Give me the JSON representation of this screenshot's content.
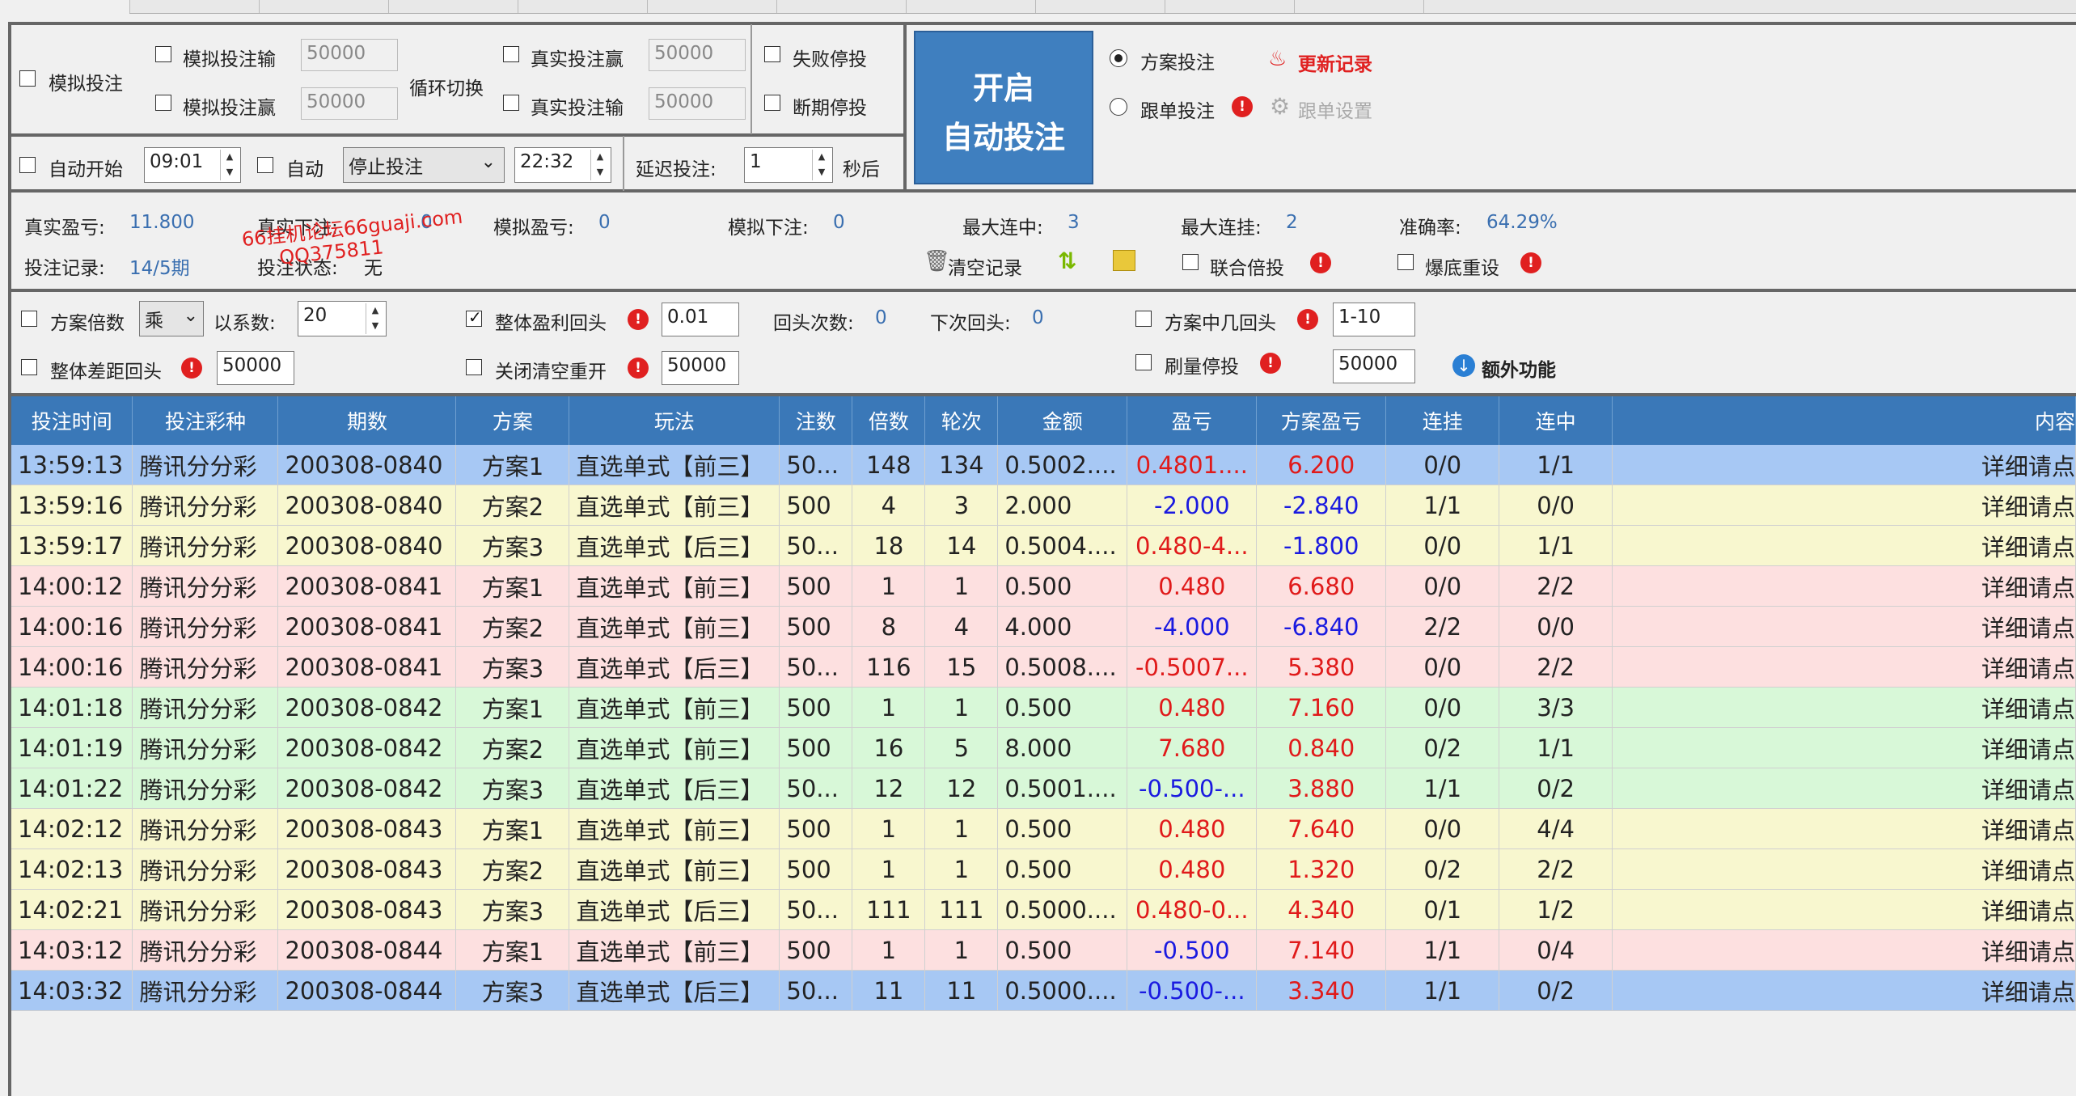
{
  "top": {
    "sim_bet": "模拟投注",
    "sim_loss": "模拟投注输",
    "sim_win": "模拟投注赢",
    "sim_loss_value": "50000",
    "sim_win_value": "50000",
    "cycle": "循环切换",
    "real_win": "真实投注赢",
    "real_loss": "真实投注输",
    "real_win_value": "50000",
    "real_loss_value": "50000",
    "fail_stop": "失败停投",
    "break_stop": "断期停投",
    "start_btn_line1": "开启",
    "start_btn_line2": "自动投注",
    "plan_bet": "方案投注",
    "follow_bet": "跟单投注",
    "update_log": "更新记录",
    "follow_settings": "跟单设置",
    "auto_start": "自动开始",
    "auto_start_time": "09:01",
    "auto": "自动",
    "stop_bet": "停止投注",
    "stop_time": "22:32",
    "delay": "延迟投注:",
    "delay_value": "1",
    "seconds": "秒后"
  },
  "stats": {
    "real_pl_label": "真实盈亏:",
    "real_pl": "11.800",
    "real_bet_label": "真实下注:",
    "real_bet": "0",
    "sim_pl_label": "模拟盈亏:",
    "sim_pl": "0",
    "sim_bet_label": "模拟下注:",
    "sim_bet": "0",
    "max_win_label": "最大连中:",
    "max_win": "3",
    "max_loss_label": "最大连挂:",
    "max_loss": "2",
    "accuracy_label": "准确率:",
    "accuracy": "64.29%",
    "record_label": "投注记录:",
    "record": "14/5期",
    "status_label": "投注状态:",
    "status": "无",
    "clear": "清空记录",
    "joint_double": "联合倍投",
    "bust_reset": "爆底重设",
    "watermark1": "66挂机论坛66guaji.com",
    "watermark2": "QQ375811"
  },
  "opts": {
    "plan_mult": "方案倍数",
    "mult_op": "乘",
    "coef_label": "以系数:",
    "coef": "20",
    "total_profit_back": "整体盈利回头",
    "total_profit_value": "0.01",
    "back_count_label": "回头次数:",
    "back_count": "0",
    "next_back_label": "下次回头:",
    "next_back": "0",
    "plan_hit_back": "方案中几回头",
    "plan_hit_value": "1-10",
    "total_gap_back": "整体差距回头",
    "total_gap_value": "50000",
    "close_reset": "关闭清空重开",
    "close_reset_value": "50000",
    "volume_stop": "刷量停投",
    "volume_stop_value": "50000",
    "extra": "额外功能"
  },
  "table": {
    "headers": [
      "投注时间",
      "投注彩种",
      "期数",
      "方案",
      "玩法",
      "注数",
      "倍数",
      "轮次",
      "金额",
      "盈亏",
      "方案盈亏",
      "连挂",
      "连中",
      "内容"
    ],
    "rows": [
      {
        "c": [
          "13:59:13",
          "腾讯分分彩",
          "200308-0840",
          "方案1",
          "直选单式【前三】",
          "50...",
          "148",
          "134",
          "0.5002....",
          "0.4801....",
          "6.200",
          "0/0",
          "1/1",
          "详细请点"
        ],
        "bg": "#a7c8f4",
        "pl": "pos",
        "ppl": "pos"
      },
      {
        "c": [
          "13:59:16",
          "腾讯分分彩",
          "200308-0840",
          "方案2",
          "直选单式【前三】",
          "500",
          "4",
          "3",
          "2.000",
          "-2.000",
          "-2.840",
          "1/1",
          "0/0",
          "详细请点"
        ],
        "bg": "#f8f7cf",
        "pl": "neg",
        "ppl": "neg"
      },
      {
        "c": [
          "13:59:17",
          "腾讯分分彩",
          "200308-0840",
          "方案3",
          "直选单式【后三】",
          "50...",
          "18",
          "14",
          "0.5004....",
          "0.480-4...",
          "-1.800",
          "0/0",
          "1/1",
          "详细请点"
        ],
        "bg": "#f8f7cf",
        "pl": "pos",
        "ppl": "neg"
      },
      {
        "c": [
          "14:00:12",
          "腾讯分分彩",
          "200308-0841",
          "方案1",
          "直选单式【前三】",
          "500",
          "1",
          "1",
          "0.500",
          "0.480",
          "6.680",
          "0/0",
          "2/2",
          "详细请点"
        ],
        "bg": "#fde0e0",
        "pl": "pos",
        "ppl": "pos"
      },
      {
        "c": [
          "14:00:16",
          "腾讯分分彩",
          "200308-0841",
          "方案2",
          "直选单式【前三】",
          "500",
          "8",
          "4",
          "4.000",
          "-4.000",
          "-6.840",
          "2/2",
          "0/0",
          "详细请点"
        ],
        "bg": "#fde0e0",
        "pl": "neg",
        "ppl": "neg"
      },
      {
        "c": [
          "14:00:16",
          "腾讯分分彩",
          "200308-0841",
          "方案3",
          "直选单式【后三】",
          "50...",
          "116",
          "15",
          "0.5008....",
          "-0.5007...",
          "5.380",
          "0/0",
          "2/2",
          "详细请点"
        ],
        "bg": "#fde0e0",
        "pl": "pos",
        "ppl": "pos"
      },
      {
        "c": [
          "14:01:18",
          "腾讯分分彩",
          "200308-0842",
          "方案1",
          "直选单式【前三】",
          "500",
          "1",
          "1",
          "0.500",
          "0.480",
          "7.160",
          "0/0",
          "3/3",
          "详细请点"
        ],
        "bg": "#d8f8d8",
        "pl": "pos",
        "ppl": "pos"
      },
      {
        "c": [
          "14:01:19",
          "腾讯分分彩",
          "200308-0842",
          "方案2",
          "直选单式【前三】",
          "500",
          "16",
          "5",
          "8.000",
          "7.680",
          "0.840",
          "0/2",
          "1/1",
          "详细请点"
        ],
        "bg": "#d8f8d8",
        "pl": "pos",
        "ppl": "pos"
      },
      {
        "c": [
          "14:01:22",
          "腾讯分分彩",
          "200308-0842",
          "方案3",
          "直选单式【后三】",
          "50...",
          "12",
          "12",
          "0.5001....",
          "-0.500-...",
          "3.880",
          "1/1",
          "0/2",
          "详细请点"
        ],
        "bg": "#d8f8d8",
        "pl": "neg",
        "ppl": "pos"
      },
      {
        "c": [
          "14:02:12",
          "腾讯分分彩",
          "200308-0843",
          "方案1",
          "直选单式【前三】",
          "500",
          "1",
          "1",
          "0.500",
          "0.480",
          "7.640",
          "0/0",
          "4/4",
          "详细请点"
        ],
        "bg": "#f8f7cf",
        "pl": "pos",
        "ppl": "pos"
      },
      {
        "c": [
          "14:02:13",
          "腾讯分分彩",
          "200308-0843",
          "方案2",
          "直选单式【前三】",
          "500",
          "1",
          "1",
          "0.500",
          "0.480",
          "1.320",
          "0/2",
          "2/2",
          "详细请点"
        ],
        "bg": "#f8f7cf",
        "pl": "pos",
        "ppl": "pos"
      },
      {
        "c": [
          "14:02:21",
          "腾讯分分彩",
          "200308-0843",
          "方案3",
          "直选单式【后三】",
          "50...",
          "111",
          "111",
          "0.5000....",
          "0.480-0...",
          "4.340",
          "0/1",
          "1/2",
          "详细请点"
        ],
        "bg": "#f8f7cf",
        "pl": "pos",
        "ppl": "pos"
      },
      {
        "c": [
          "14:03:12",
          "腾讯分分彩",
          "200308-0844",
          "方案1",
          "直选单式【前三】",
          "500",
          "1",
          "1",
          "0.500",
          "-0.500",
          "7.140",
          "1/1",
          "0/4",
          "详细请点"
        ],
        "bg": "#fde0e0",
        "pl": "neg",
        "ppl": "pos"
      },
      {
        "c": [
          "14:03:32",
          "腾讯分分彩",
          "200308-0844",
          "方案3",
          "直选单式【后三】",
          "50...",
          "11",
          "11",
          "0.5000....",
          "-0.500-...",
          "3.340",
          "1/1",
          "0/2",
          "详细请点"
        ],
        "bg": "#a7c8f4",
        "pl": "neg",
        "ppl": "pos"
      }
    ]
  },
  "colors": {
    "header_bg": "#3a78b8",
    "start_btn": "#3f7fbf",
    "negative": "#1a1ae0",
    "positive": "#e01a1a",
    "stat_value": "#3a6fb0"
  }
}
